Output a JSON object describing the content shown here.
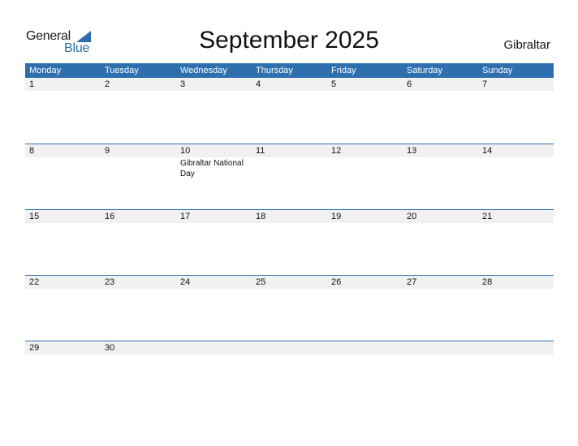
{
  "logo": {
    "part1": "General",
    "part2": "Blue",
    "accent_color": "#2e6fb0"
  },
  "title": "September 2025",
  "country": "Gibraltar",
  "weekdays": [
    "Monday",
    "Tuesday",
    "Wednesday",
    "Thursday",
    "Friday",
    "Saturday",
    "Sunday"
  ],
  "weeks": [
    {
      "days": [
        "1",
        "2",
        "3",
        "4",
        "5",
        "6",
        "7"
      ],
      "notes": [
        "",
        "",
        "",
        "",
        "",
        "",
        ""
      ]
    },
    {
      "days": [
        "8",
        "9",
        "10",
        "11",
        "12",
        "13",
        "14"
      ],
      "notes": [
        "",
        "",
        "Gibraltar National Day",
        "",
        "",
        "",
        ""
      ]
    },
    {
      "days": [
        "15",
        "16",
        "17",
        "18",
        "19",
        "20",
        "21"
      ],
      "notes": [
        "",
        "",
        "",
        "",
        "",
        "",
        ""
      ]
    },
    {
      "days": [
        "22",
        "23",
        "24",
        "25",
        "26",
        "27",
        "28"
      ],
      "notes": [
        "",
        "",
        "",
        "",
        "",
        "",
        ""
      ]
    },
    {
      "days": [
        "29",
        "30",
        "",
        "",
        "",
        "",
        ""
      ],
      "notes": [
        "",
        "",
        "",
        "",
        "",
        "",
        ""
      ]
    }
  ]
}
